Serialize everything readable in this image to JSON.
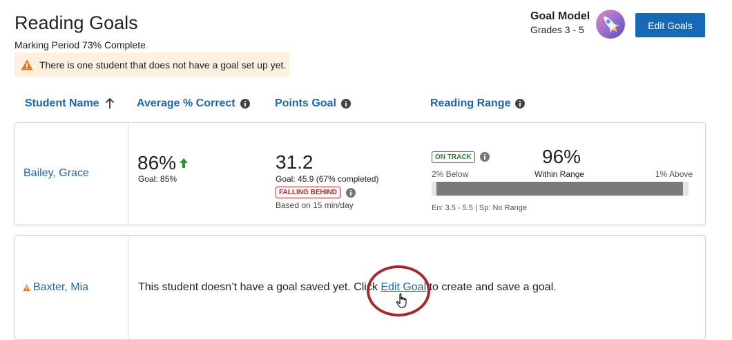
{
  "header": {
    "title": "Reading Goals",
    "marking_period": "Marking Period 73% Complete",
    "warning": "There is one student that does not have a goal set up yet."
  },
  "goal_model": {
    "label": "Goal Model",
    "grades": "Grades 3 - 5",
    "avatar_icon": "rocket-icon"
  },
  "edit_goals_button": "Edit Goals",
  "columns": {
    "student_name": "Student Name",
    "avg_correct": "Average % Correct",
    "points_goal": "Points Goal",
    "reading_range": "Reading Range"
  },
  "students": [
    {
      "name": "Bailey, Grace",
      "avg_correct": "86%",
      "avg_trend_icon": "arrow-up-icon",
      "avg_goal": "Goal: 85%",
      "points": "31.2",
      "points_goal": "Goal: 45.9 (67% completed)",
      "points_status": "FALLING BEHIND",
      "points_basis": "Based on 15 min/day",
      "range_status": "ON TRACK",
      "within_pct": "96%",
      "within_label": "Within Range",
      "below": "2% Below",
      "above": "1% Above",
      "range_bar": {
        "below_fraction": 0.02,
        "within_fraction": 0.96,
        "above_fraction": 0.01
      },
      "range_meta": "En: 3.5 - 5.5  |  Sp: No Range"
    },
    {
      "name": "Baxter, Mia",
      "warning_icon": "warning-icon",
      "message_before": "This student doesn’t have a goal saved yet. Click ",
      "edit_link": "Edit Goal",
      "message_after": " to create and save a goal."
    }
  ],
  "colors": {
    "primary": "#1769b5",
    "link": "#1c66ad",
    "warning_bg": "#fdf0e0",
    "warning_icon": "#e87b1e",
    "on_track": "#2e7d32",
    "falling_behind": "#b1252c",
    "up_arrow": "#2e8b2e",
    "annotation_ring": "#a32a2a"
  }
}
